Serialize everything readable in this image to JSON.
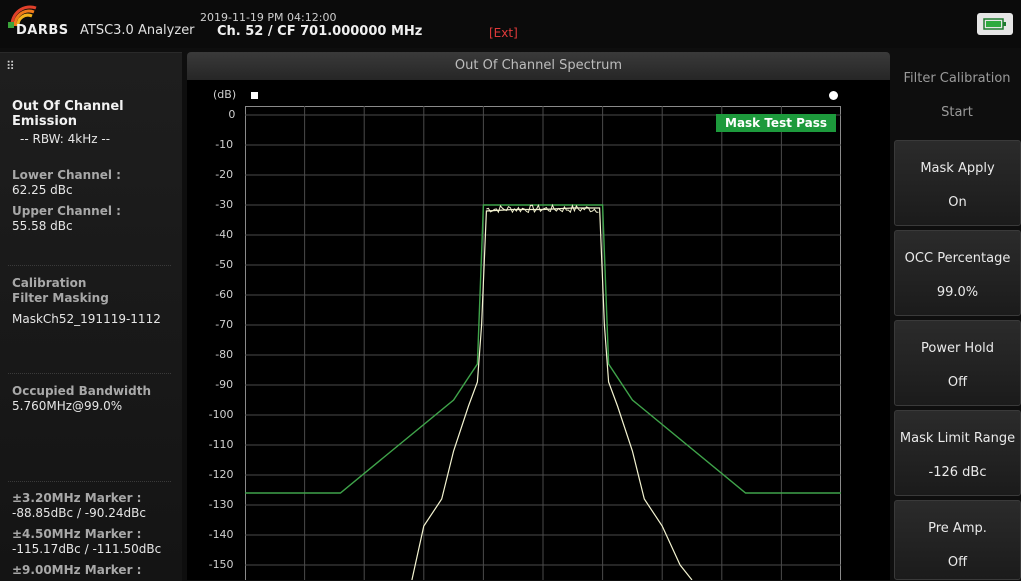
{
  "header": {
    "brand": "DARBS",
    "app_title": "ATSC3.0 Analyzer",
    "datetime": "2019-11-19 PM 04:12:00",
    "channel": "Ch. 52 / CF 701.000000 MHz",
    "ext_label": "[Ext]"
  },
  "left_panel": {
    "title": "Out Of Channel Emission",
    "rbw": "-- RBW: 4kHz --",
    "lower_channel_label": "Lower Channel :",
    "lower_channel_value": "62.25 dBc",
    "upper_channel_label": "Upper Channel :",
    "upper_channel_value": "55.58 dBc",
    "calibration_label_1": "Calibration",
    "calibration_label_2": "Filter Masking",
    "mask_file": "MaskCh52_191119-1112",
    "occupied_bw_label": "Occupied Bandwidth",
    "occupied_bw_value": "5.760MHz@99.0%",
    "marker1_label": "±3.20MHz Marker :",
    "marker1_value": "-88.85dBc / -90.24dBc",
    "marker2_label": "±4.50MHz Marker :",
    "marker2_value": "-115.17dBc / -111.50dBc",
    "marker3_label": "±9.00MHz Marker :"
  },
  "chart_title": "Out Of Channel Spectrum",
  "chart_status": "Mask Test Pass",
  "chart_data": {
    "type": "line",
    "ylabel": "(dB)",
    "ylim": [
      -155,
      0
    ],
    "yticks": [
      "0",
      "-10",
      "-20",
      "-30",
      "-40",
      "-50",
      "-60",
      "-70",
      "-80",
      "-90",
      "-100",
      "-110",
      "-120",
      "-130",
      "-140",
      "-150"
    ],
    "grid": true,
    "series": [
      {
        "color": "#3fa34a",
        "x": [
          0,
          1.6,
          3.5,
          3.9,
          4.0,
          6.0,
          6.1,
          6.5,
          8.4,
          10
        ],
        "values": [
          -126,
          -126,
          -95,
          -83,
          -30,
          -30,
          -83,
          -95,
          -126,
          -126
        ]
      },
      {
        "color": "#f3f3d0",
        "x": [
          2.8,
          3.0,
          3.3,
          3.5,
          3.75,
          3.9,
          3.97,
          4.05,
          4.5,
          5.0,
          5.5,
          5.95,
          6.03,
          6.1,
          6.25,
          6.5,
          6.7,
          7.0,
          7.3,
          7.5
        ],
        "values": [
          -155,
          -137,
          -128,
          -112,
          -97,
          -89,
          -70,
          -32,
          -31.5,
          -31.5,
          -31,
          -31,
          -70,
          -89,
          -97,
          -112,
          -128,
          -137,
          -150,
          -155
        ]
      }
    ]
  },
  "right_panel": {
    "filter_calibration_label": "Filter Calibration",
    "start_label": "Start",
    "buttons": [
      {
        "title": "Mask Apply",
        "value": "On"
      },
      {
        "title": "OCC Percentage",
        "value": "99.0%"
      },
      {
        "title": "Power Hold",
        "value": "Off"
      },
      {
        "title": "Mask Limit Range",
        "value": "-126 dBc"
      },
      {
        "title": "Pre Amp.",
        "value": "Off"
      }
    ]
  },
  "colors": {
    "mask_line": "#3fa34a",
    "spectrum_trace": "#f3f3d0",
    "pass_badge": "#1d9a3c",
    "ext_label": "#e03a3a"
  }
}
